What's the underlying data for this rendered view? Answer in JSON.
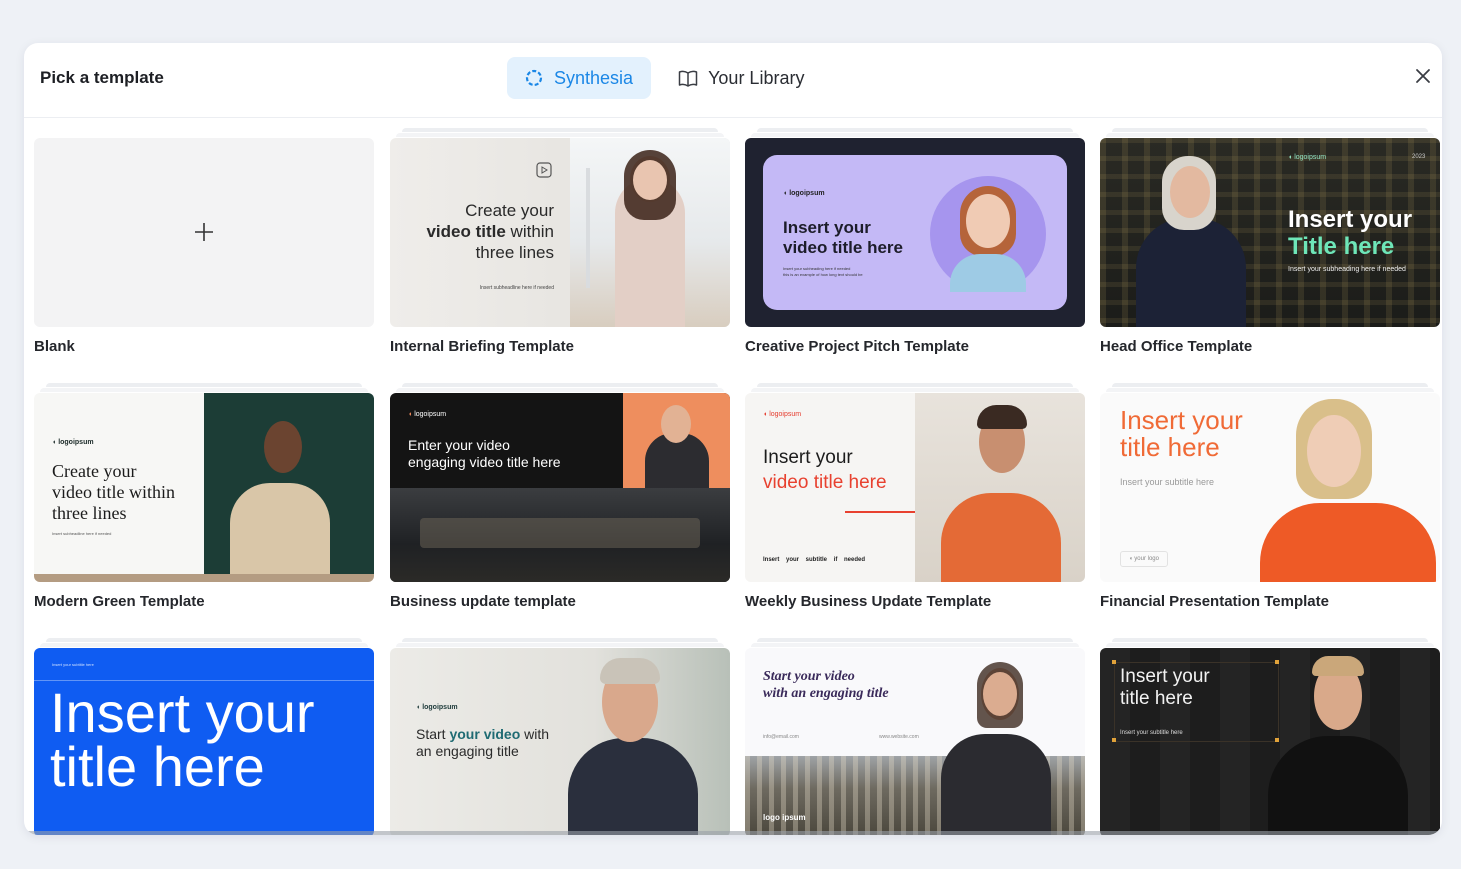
{
  "modal": {
    "title": "Pick a template",
    "tabs": [
      {
        "label": "Synthesia",
        "icon": "synthesia-icon",
        "active": true
      },
      {
        "label": "Your Library",
        "icon": "book-icon",
        "active": false
      }
    ]
  },
  "templates": [
    {
      "label": "Blank"
    },
    {
      "label": "Internal Briefing Template",
      "thumb": {
        "line1": "Create your",
        "line2a": "video title",
        "line2b": " within",
        "line3": "three lines",
        "sub": "Insert subheadline here if needed"
      }
    },
    {
      "label": "Creative Project Pitch Template",
      "thumb": {
        "logo": "logoipsum",
        "line1": "Insert your",
        "line2": "video title here",
        "sub1": "Insert your subheading here if needed",
        "sub2": "this is an example of how long text should be"
      }
    },
    {
      "label": "Head Office Template",
      "thumb": {
        "logo": "logoipsum",
        "year": "2023",
        "line1": "Insert your",
        "line2": "Title here",
        "sub": "Insert your subheading here if needed"
      }
    },
    {
      "label": "Modern Green Template",
      "thumb": {
        "logo": "logoipsum",
        "line1": "Create your",
        "line2": "video title within",
        "line3": "three lines",
        "sub": "Insert subheadline here if needed"
      }
    },
    {
      "label": "Business update template",
      "thumb": {
        "logo": "logoipsum",
        "line1": "Enter your video",
        "line2": "engaging video title here"
      }
    },
    {
      "label": "Weekly Business Update Template",
      "thumb": {
        "logo": "logoipsum",
        "line1": "Insert your",
        "line2": "video title here",
        "sub": "Insert    your    subtitle    if    needed"
      }
    },
    {
      "label": "Financial Presentation Template",
      "thumb": {
        "line1": "Insert your",
        "line2": "title here",
        "sub": "Insert your subtitle here",
        "logo": "your logo"
      }
    },
    {
      "label": "",
      "thumb": {
        "sub": "Insert your subtitle here",
        "line1": "Insert your",
        "line2": "title here"
      }
    },
    {
      "label": "",
      "thumb": {
        "logo": "logoipsum",
        "line1a": "Start ",
        "line1b": "your video",
        "line1c": " with",
        "line2": "an engaging title"
      }
    },
    {
      "label": "",
      "thumb": {
        "line1": "Start your video",
        "line2": "with an engaging title",
        "left": "info@email.com",
        "right": "www.website.com",
        "logo": "logo ipsum"
      }
    },
    {
      "label": "",
      "thumb": {
        "line1": "Insert your",
        "line2": "title here",
        "sub": "Insert your subtitle here"
      }
    }
  ],
  "colors": {
    "accent": "#1b87e6",
    "tab_active_bg": "#e3f1fd",
    "creative_purple": "#c4b9f6",
    "green_panel": "#1c3d36",
    "orange_accent": "#f26b3a",
    "blue_template": "#0f5cf2"
  }
}
